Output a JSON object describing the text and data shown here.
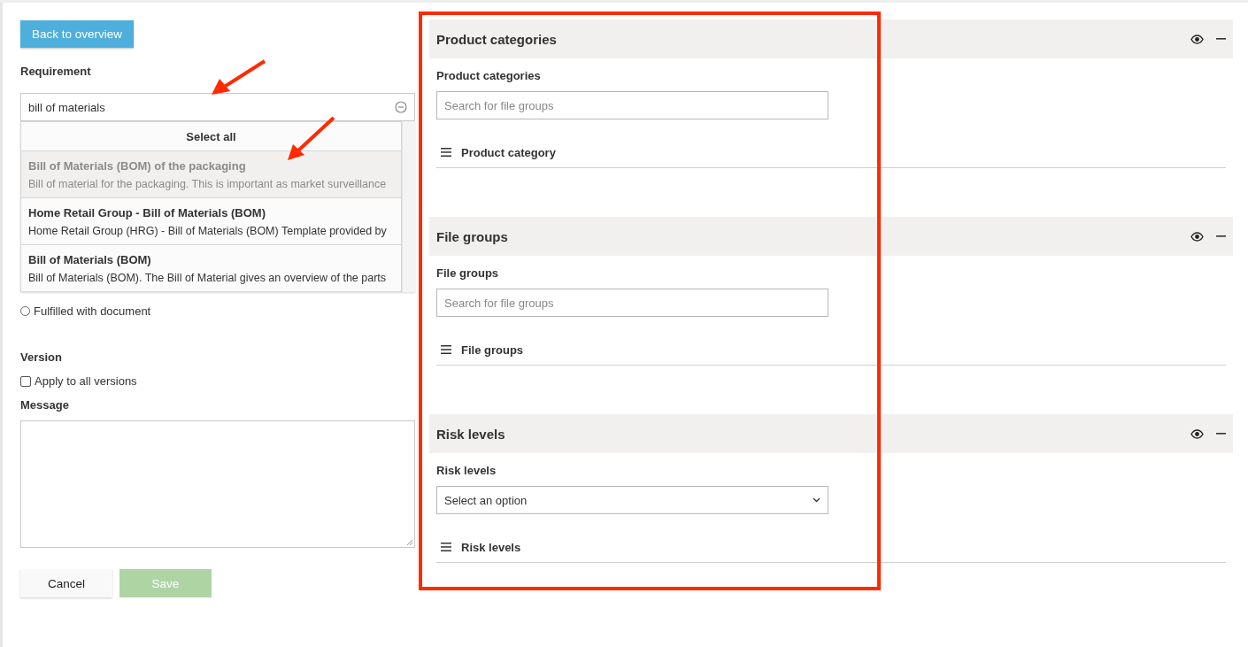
{
  "back_button": "Back to overview",
  "requirement": {
    "label": "Requirement",
    "value": "bill of materials",
    "dropdown": {
      "select_all": "Select all",
      "options": [
        {
          "title": "Bill of Materials (BOM) of the packaging",
          "description": "Bill of material for the packaging. This is important as market surveillance",
          "selected": true
        },
        {
          "title": "Home Retail Group - Bill of Materials (BOM)",
          "description": "Home Retail Group (HRG) - Bill of Materials (BOM) Template provided by",
          "selected": false
        },
        {
          "title": "Bill of Materials (BOM)",
          "description": "Bill of Materials (BOM). The Bill of Material gives an overview of the parts",
          "selected": false
        }
      ]
    }
  },
  "status_options": [
    {
      "label": "Fulfilled with document",
      "selected": false
    }
  ],
  "version": {
    "label": "Version",
    "checkbox": {
      "label": "Apply to all versions",
      "checked": false
    }
  },
  "message": {
    "label": "Message"
  },
  "buttons": [
    {
      "label": "Cancel",
      "kind": "secondary",
      "disabled": false
    },
    {
      "label": "Save",
      "kind": "primary",
      "disabled": true
    }
  ],
  "sections": [
    {
      "title": "Product categories",
      "field_label": "Product categories",
      "field": {
        "kind": "search",
        "placeholder": "Search for file groups"
      },
      "list_header": "Product category"
    },
    {
      "title": "File groups",
      "field_label": "File groups",
      "field": {
        "kind": "search",
        "placeholder": "Search for file groups"
      },
      "list_header": "File groups"
    },
    {
      "title": "Risk levels",
      "field_label": "Risk levels",
      "field": {
        "kind": "select",
        "value": "Select an option"
      },
      "list_header": "Risk levels"
    }
  ]
}
